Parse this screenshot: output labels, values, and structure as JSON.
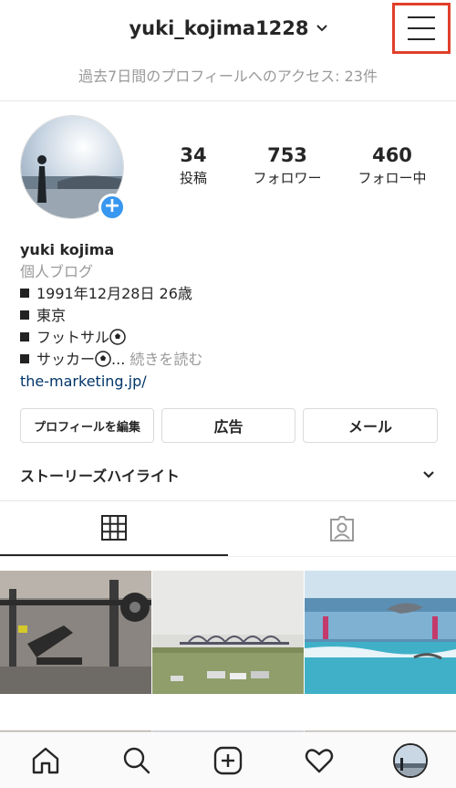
{
  "header": {
    "username": "yuki_kojima1228",
    "chevron_icon": "chevron-down-icon",
    "menu_icon": "hamburger-menu-icon"
  },
  "access": {
    "label": "過去7日間のプロフィールへのアクセス: ",
    "count": "23件"
  },
  "stats": [
    {
      "count": "34",
      "label": "投稿"
    },
    {
      "count": "753",
      "label": "フォロワー"
    },
    {
      "count": "460",
      "label": "フォロー中"
    }
  ],
  "bio": {
    "name": "yuki kojima",
    "category": "個人ブログ",
    "lines": [
      "1991年12月28日 26歳",
      "東京",
      "フットサル",
      "サッカー"
    ],
    "ellipsis": "...",
    "more": "続きを読む",
    "link": "the-marketing.jp/"
  },
  "buttons": {
    "edit": "プロフィールを編集",
    "ads": "広告",
    "mail": "メール"
  },
  "highlights": {
    "title": "ストーリーズハイライト"
  },
  "tabs": [
    "grid-icon",
    "tagged-person-icon"
  ],
  "nav": [
    "home-icon",
    "search-icon",
    "add-post-icon",
    "heart-icon",
    "profile-avatar"
  ],
  "colors": {
    "link": "#003569",
    "badge": "#3897f0",
    "highlight_border": "#e0402a",
    "muted": "#999999"
  }
}
